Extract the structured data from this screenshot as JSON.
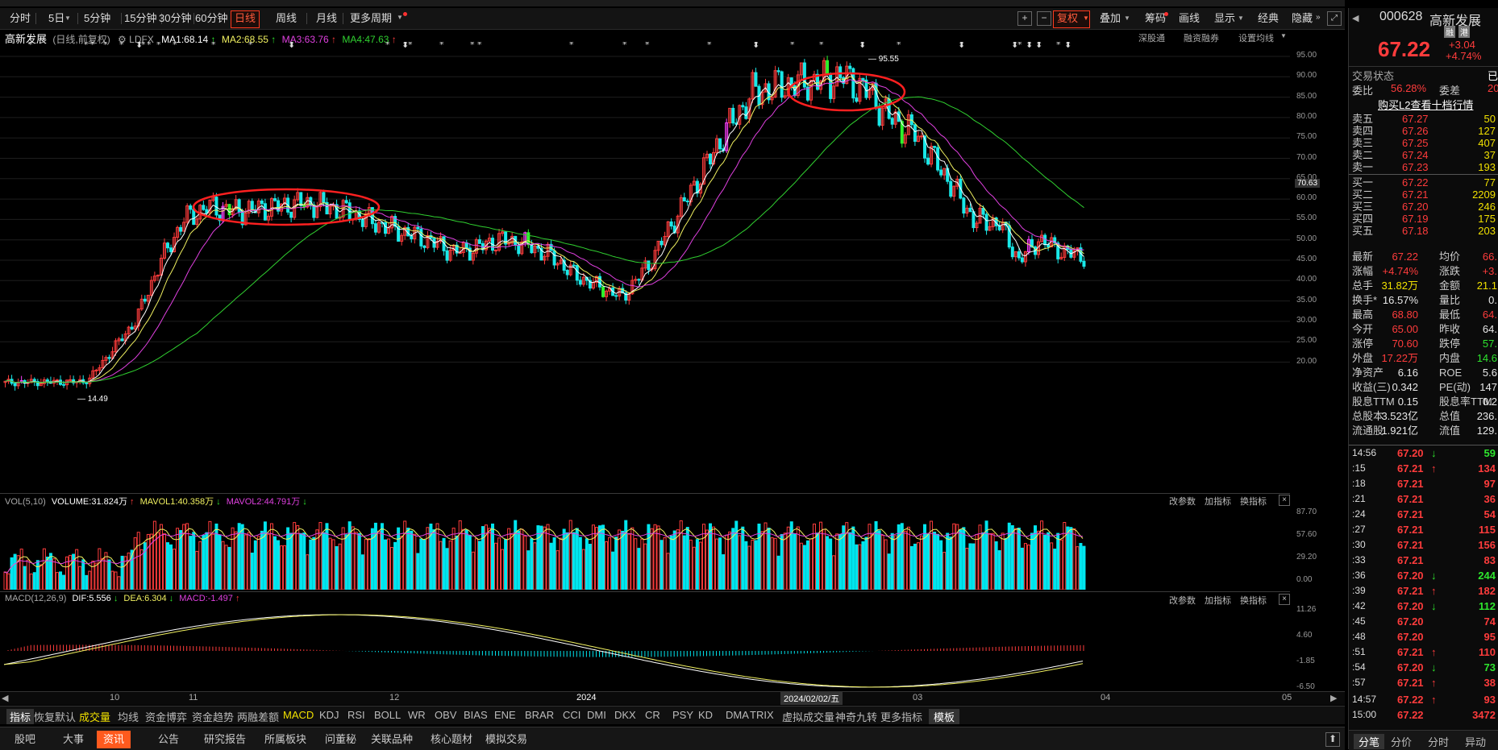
{
  "toolbar": {
    "periods": [
      "分时",
      "5日",
      "5分钟",
      "15分钟",
      "30分钟",
      "60分钟",
      "日线",
      "周线",
      "月线",
      "更多周期"
    ],
    "active_period": "日线",
    "right_tools": [
      "复权",
      "叠加",
      "筹码",
      "画线",
      "显示",
      "经典",
      "隐藏"
    ]
  },
  "stock": {
    "code": "000628",
    "name": "高新发展",
    "price": "67.22",
    "change": "+3.04",
    "change_pct": "+4.74%",
    "tags": [
      "融",
      "港"
    ],
    "rating": "已收"
  },
  "chart_header": {
    "name": "高新发展",
    "mode": "(日线,前复权)",
    "indicator": "LDFX",
    "ma1": "MA1:68.14",
    "ma2": "MA2:68.55",
    "ma3": "MA3:63.76",
    "ma4": "MA4:47.63",
    "links": [
      "深股通",
      "融资融券",
      "设置均线"
    ]
  },
  "price_axis": [
    "95.00",
    "90.00",
    "85.00",
    "80.00",
    "75.00",
    "70.00",
    "65.00",
    "60.00",
    "55.00",
    "50.00",
    "45.00",
    "40.00",
    "35.00",
    "30.00",
    "25.00",
    "20.00"
  ],
  "current_price_tag": "70.63",
  "annotations": {
    "high": "95.55",
    "low": "14.49"
  },
  "volume_panel": {
    "title": "VOL(5,10)",
    "volume": "VOLUME:31.824万",
    "mavol1": "MAVOL1:40.358万",
    "mavol2": "MAVOL2:44.791万",
    "axis": [
      "87.70",
      "57.60",
      "29.20",
      "0.00"
    ],
    "actions": [
      "改参数",
      "加指标",
      "换指标"
    ]
  },
  "macd_panel": {
    "title": "MACD(12,26,9)",
    "dif": "DIF:5.556",
    "dea": "DEA:6.304",
    "macd": "MACD:-1.497",
    "axis": [
      "11.26",
      "4.60",
      "-1.85",
      "-6.50"
    ],
    "actions": [
      "改参数",
      "加指标",
      "换指标"
    ]
  },
  "date_axis": [
    "10",
    "11",
    "12",
    "2024",
    "03",
    "04",
    "05"
  ],
  "date_cursor": "2024/02/02/五",
  "indicator_tabs": [
    "指标",
    "恢复默认",
    "成交量",
    "均线",
    "资金博弈",
    "资金趋势",
    "两融差额",
    "MACD",
    "KDJ",
    "RSI",
    "BOLL",
    "WR",
    "OBV",
    "BIAS",
    "ENE",
    "BRAR",
    "CCI",
    "DMI",
    "DKX",
    "CR",
    "PSY",
    "KD",
    "DMA",
    "TRIX",
    "虚拟成交量",
    "神奇九转",
    "更多指标",
    "模板"
  ],
  "bottom_tabs": [
    "股吧",
    "大事",
    "资讯",
    "公告",
    "研究报告",
    "所属板块",
    "问董秘",
    "关联品种",
    "核心题材",
    "模拟交易"
  ],
  "active_bottom_tab": "资讯",
  "quote": {
    "trade_status_label": "交易状态",
    "trade_status": "已收",
    "weibi_label": "委比",
    "weibi": "56.28%",
    "weicha_label": "委差",
    "weicha": "20",
    "l2_link": "购买L2查看十档行情",
    "asks": [
      {
        "label": "卖五",
        "price": "67.27",
        "vol": "50"
      },
      {
        "label": "卖四",
        "price": "67.26",
        "vol": "127"
      },
      {
        "label": "卖三",
        "price": "67.25",
        "vol": "407"
      },
      {
        "label": "卖二",
        "price": "67.24",
        "vol": "37"
      },
      {
        "label": "卖一",
        "price": "67.23",
        "vol": "193"
      }
    ],
    "bids": [
      {
        "label": "买一",
        "price": "67.22",
        "vol": "77"
      },
      {
        "label": "买二",
        "price": "67.21",
        "vol": "2209"
      },
      {
        "label": "买三",
        "price": "67.20",
        "vol": "246"
      },
      {
        "label": "买四",
        "price": "67.19",
        "vol": "175"
      },
      {
        "label": "买五",
        "price": "67.18",
        "vol": "203"
      }
    ],
    "stats": [
      {
        "k1": "最新",
        "v1": "67.22",
        "c1": "red",
        "k2": "均价",
        "v2": "66.",
        "c2": "red"
      },
      {
        "k1": "涨幅",
        "v1": "+4.74%",
        "c1": "red",
        "k2": "涨跌",
        "v2": "+3.",
        "c2": "red"
      },
      {
        "k1": "总手",
        "v1": "31.82万",
        "c1": "yel",
        "k2": "金额",
        "v2": "21.1",
        "c2": "yel"
      },
      {
        "k1": "换手*",
        "v1": "16.57%",
        "c1": "wht",
        "k2": "量比",
        "v2": "0.",
        "c2": "wht"
      },
      {
        "k1": "最高",
        "v1": "68.80",
        "c1": "red",
        "k2": "最低",
        "v2": "64.",
        "c2": "red"
      },
      {
        "k1": "今开",
        "v1": "65.00",
        "c1": "red",
        "k2": "昨收",
        "v2": "64.",
        "c2": "wht"
      },
      {
        "k1": "涨停",
        "v1": "70.60",
        "c1": "red",
        "k2": "跌停",
        "v2": "57.",
        "c2": "green"
      },
      {
        "k1": "外盘",
        "v1": "17.22万",
        "c1": "red",
        "k2": "内盘",
        "v2": "14.6",
        "c2": "green"
      },
      {
        "k1": "净资产",
        "v1": "6.16",
        "c1": "wht",
        "k2": "ROE",
        "v2": "5.6",
        "c2": "wht"
      },
      {
        "k1": "收益(三)",
        "v1": "0.342",
        "c1": "wht",
        "k2": "PE(动)",
        "v2": "147",
        "c2": "wht"
      },
      {
        "k1": "股息TTM",
        "v1": "0.15",
        "c1": "wht",
        "k2": "股息率TTM",
        "v2": "0.2",
        "c2": "wht"
      },
      {
        "k1": "总股本",
        "v1": "3.523亿",
        "c1": "wht",
        "k2": "总值",
        "v2": "236.",
        "c2": "wht"
      },
      {
        "k1": "流通股",
        "v1": "1.921亿",
        "c1": "wht",
        "k2": "流值",
        "v2": "129.",
        "c2": "wht"
      }
    ],
    "ticks": [
      {
        "t": "14:56",
        "p": "67.20",
        "d": "down",
        "v": "59"
      },
      {
        "t": ":15",
        "p": "67.21",
        "d": "up",
        "v": "134"
      },
      {
        "t": ":18",
        "p": "67.21",
        "d": "",
        "v": "97"
      },
      {
        "t": ":21",
        "p": "67.21",
        "d": "",
        "v": "36"
      },
      {
        "t": ":24",
        "p": "67.21",
        "d": "",
        "v": "54"
      },
      {
        "t": ":27",
        "p": "67.21",
        "d": "",
        "v": "115"
      },
      {
        "t": ":30",
        "p": "67.21",
        "d": "",
        "v": "156"
      },
      {
        "t": ":33",
        "p": "67.21",
        "d": "",
        "v": "83"
      },
      {
        "t": ":36",
        "p": "67.20",
        "d": "down",
        "v": "244"
      },
      {
        "t": ":39",
        "p": "67.21",
        "d": "up",
        "v": "182"
      },
      {
        "t": ":42",
        "p": "67.20",
        "d": "down",
        "v": "112"
      },
      {
        "t": ":45",
        "p": "67.20",
        "d": "",
        "v": "74"
      },
      {
        "t": ":48",
        "p": "67.20",
        "d": "",
        "v": "95"
      },
      {
        "t": ":51",
        "p": "67.21",
        "d": "up",
        "v": "110"
      },
      {
        "t": ":54",
        "p": "67.20",
        "d": "down",
        "v": "73"
      },
      {
        "t": ":57",
        "p": "67.21",
        "d": "up",
        "v": "38"
      },
      {
        "t": "14:57",
        "p": "67.22",
        "d": "up",
        "v": "93"
      },
      {
        "t": "15:00",
        "p": "67.22",
        "d": "",
        "v": "3472"
      }
    ],
    "tabs": [
      "分笔",
      "分价",
      "分时",
      "异动"
    ]
  },
  "colors": {
    "up": "#ff3c3c",
    "down": "#00e5ee",
    "down_candle": "#19e8e8",
    "green_candle": "#2cf22c",
    "ma1": "#ffffff",
    "ma2": "#f0f060",
    "ma3": "#e040e0",
    "ma4": "#30d030",
    "circle": "#ff2020"
  }
}
